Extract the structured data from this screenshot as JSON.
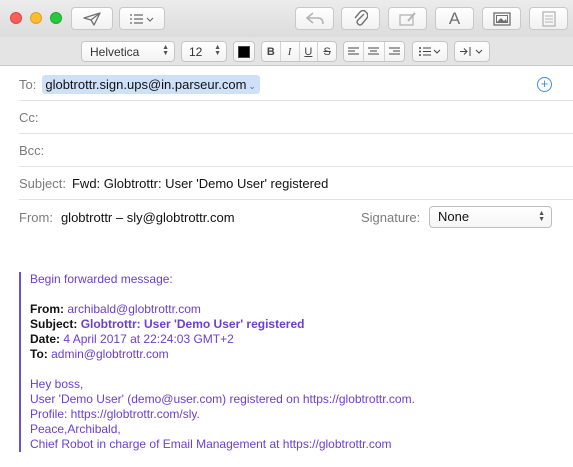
{
  "toolbar": {
    "buttons": [
      {
        "name": "send-icon"
      },
      {
        "name": "header-fields-icon"
      },
      {
        "name": "reply-icon"
      },
      {
        "name": "attach-icon"
      },
      {
        "name": "markup-icon"
      },
      {
        "name": "format-icon",
        "label": "A"
      },
      {
        "name": "photo-browser-icon"
      },
      {
        "name": "stationery-icon"
      }
    ]
  },
  "format": {
    "font": "Helvetica",
    "size": "12",
    "color": "#000000",
    "styles": [
      "B",
      "I",
      "U",
      "S"
    ],
    "list_icon": "list-icon",
    "indent_icon": "indent-icon"
  },
  "fields": {
    "to_label": "To:",
    "to_value": "globtrottr.sign.ups@in.parseur.com",
    "cc_label": "Cc:",
    "bcc_label": "Bcc:",
    "subject_label": "Subject:",
    "subject_value": "Fwd: Globtrottr: User 'Demo User' registered",
    "from_label": "From:",
    "from_value": "globtrottr – sly@globtrottr.com",
    "signature_label": "Signature:",
    "signature_value": "None"
  },
  "message": {
    "intro": "Begin forwarded message:",
    "from_label": "From:",
    "from_value": "archibald@globtrottr.com",
    "subject_label": "Subject:",
    "subject_value": "Globtrottr: User 'Demo User' registered",
    "date_label": "Date:",
    "date_value": "4 April 2017 at 22:24:03 GMT+2",
    "to_label": "To:",
    "to_value": "admin@globtrottr.com",
    "lines": [
      "Hey boss,",
      "User 'Demo User' (demo@user.com) registered on https://globtrottr.com.",
      "Profile: https://globtrottr.com/sly.",
      "Peace,Archibald,",
      "Chief Robot in charge of Email Management at https://globtrottr.com"
    ]
  },
  "colors": {
    "accent": "#3c8cf0",
    "quote": "#6b3fd0",
    "token": "#cfe1f9"
  }
}
